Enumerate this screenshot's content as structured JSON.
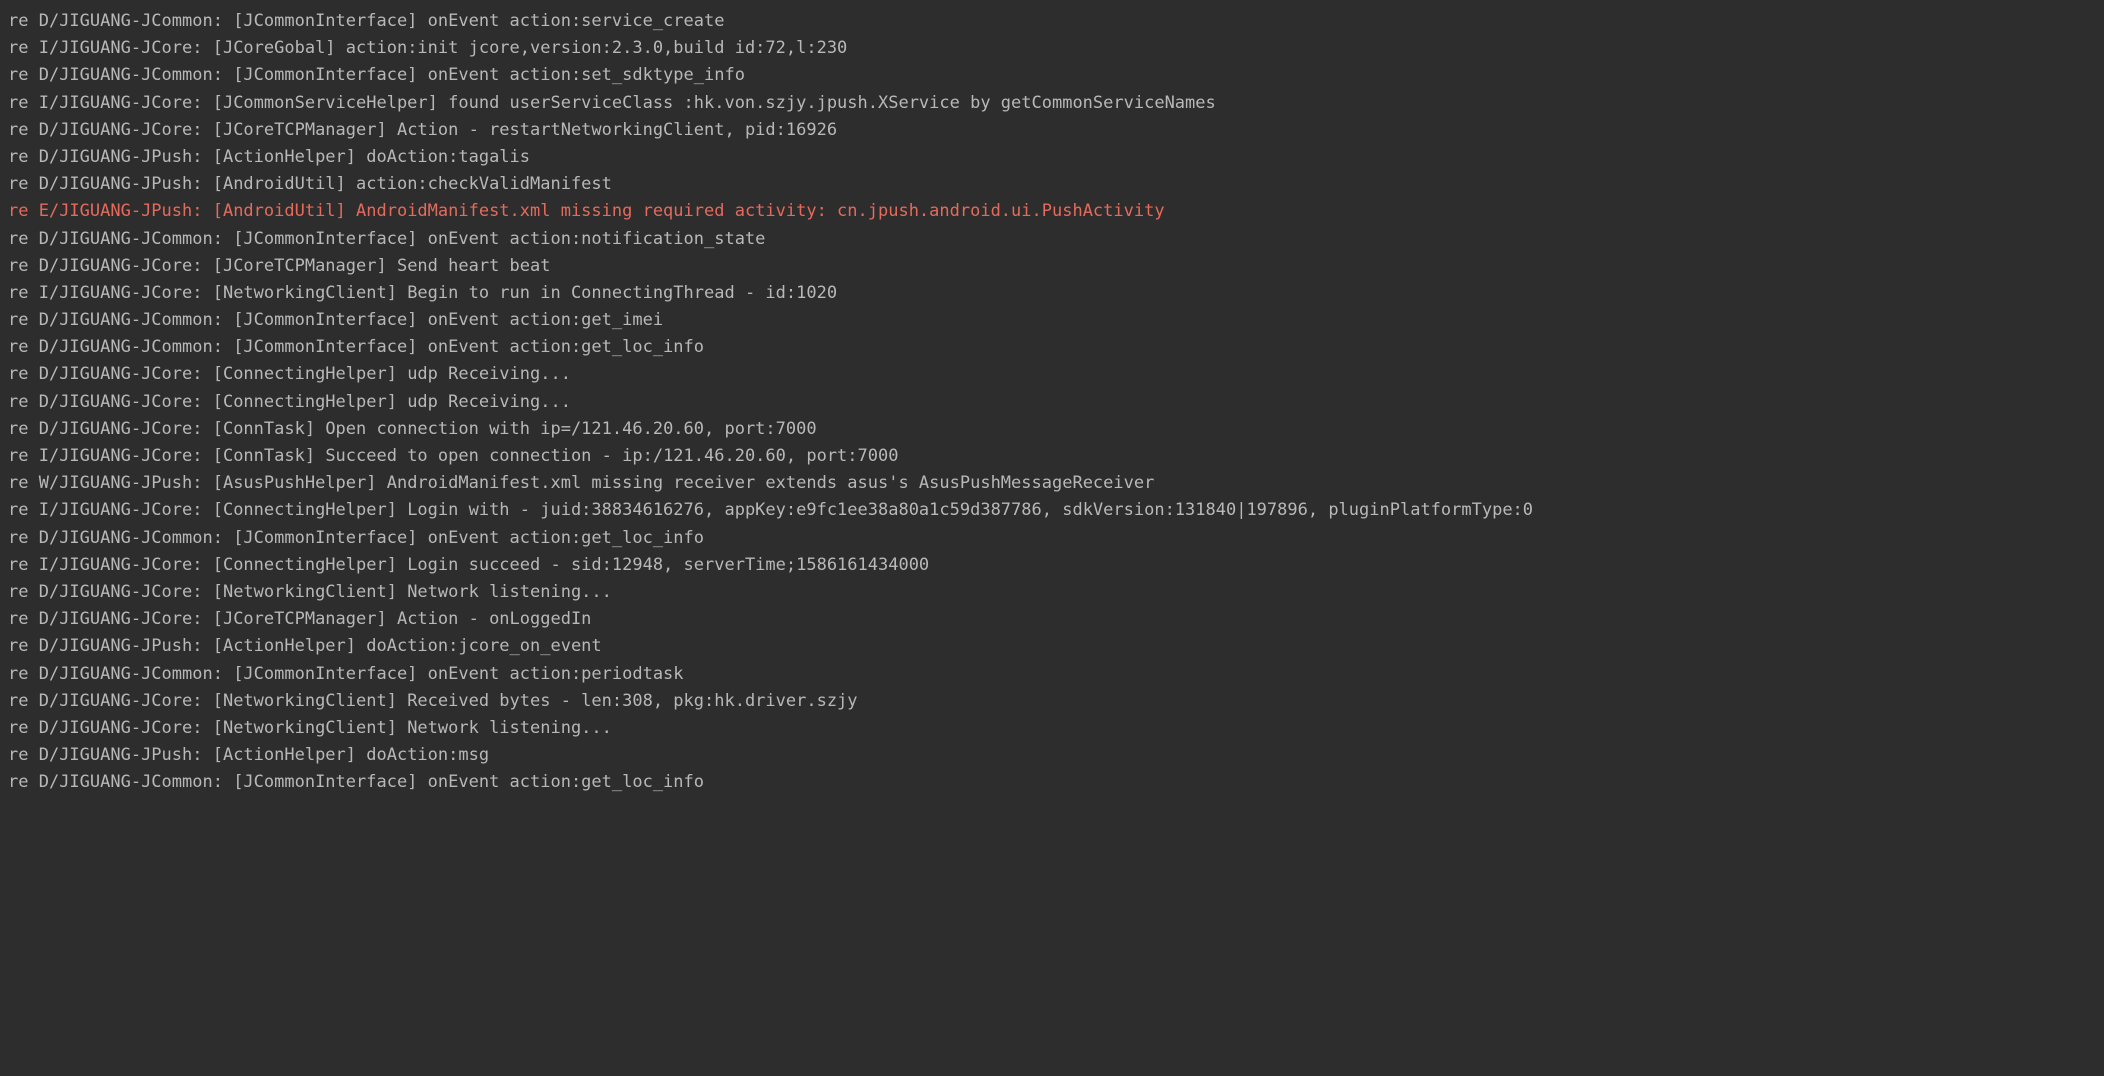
{
  "logs": [
    {
      "level": "D",
      "tag": "JIGUANG-JCommon",
      "component": "[JCommonInterface]",
      "msg": "onEvent action:service_create",
      "error": false
    },
    {
      "level": "I",
      "tag": "JIGUANG-JCore",
      "component": "[JCoreGobal]",
      "msg": "action:init jcore,version:2.3.0,build id:72,l:230",
      "error": false
    },
    {
      "level": "D",
      "tag": "JIGUANG-JCommon",
      "component": "[JCommonInterface]",
      "msg": "onEvent action:set_sdktype_info",
      "error": false
    },
    {
      "level": "I",
      "tag": "JIGUANG-JCore",
      "component": "[JCommonServiceHelper]",
      "msg": "found userServiceClass :hk.von.szjy.jpush.XService by getCommonServiceNames",
      "error": false
    },
    {
      "level": "D",
      "tag": "JIGUANG-JCore",
      "component": "[JCoreTCPManager]",
      "msg": "Action - restartNetworkingClient, pid:16926",
      "error": false
    },
    {
      "level": "D",
      "tag": "JIGUANG-JPush",
      "component": "[ActionHelper]",
      "msg": "doAction:tagalis",
      "error": false
    },
    {
      "level": "D",
      "tag": "JIGUANG-JPush",
      "component": "[AndroidUtil]",
      "msg": "action:checkValidManifest",
      "error": false
    },
    {
      "level": "E",
      "tag": "JIGUANG-JPush",
      "component": "[AndroidUtil]",
      "msg": "AndroidManifest.xml missing required activity: cn.jpush.android.ui.PushActivity",
      "error": true
    },
    {
      "level": "D",
      "tag": "JIGUANG-JCommon",
      "component": "[JCommonInterface]",
      "msg": "onEvent action:notification_state",
      "error": false
    },
    {
      "level": "D",
      "tag": "JIGUANG-JCore",
      "component": "[JCoreTCPManager]",
      "msg": "Send heart beat",
      "error": false
    },
    {
      "level": "I",
      "tag": "JIGUANG-JCore",
      "component": "[NetworkingClient]",
      "msg": "Begin to run in ConnectingThread - id:1020",
      "error": false
    },
    {
      "level": "D",
      "tag": "JIGUANG-JCommon",
      "component": "[JCommonInterface]",
      "msg": "onEvent action:get_imei",
      "error": false
    },
    {
      "level": "D",
      "tag": "JIGUANG-JCommon",
      "component": "[JCommonInterface]",
      "msg": "onEvent action:get_loc_info",
      "error": false
    },
    {
      "level": "D",
      "tag": "JIGUANG-JCore",
      "component": "[ConnectingHelper]",
      "msg": "udp Receiving...",
      "error": false
    },
    {
      "level": "D",
      "tag": "JIGUANG-JCore",
      "component": "[ConnectingHelper]",
      "msg": "udp Receiving...",
      "error": false
    },
    {
      "level": "D",
      "tag": "JIGUANG-JCore",
      "component": "[ConnTask]",
      "msg": "Open connection with ip=/121.46.20.60, port:7000",
      "error": false
    },
    {
      "level": "I",
      "tag": "JIGUANG-JCore",
      "component": "[ConnTask]",
      "msg": "Succeed to open connection - ip:/121.46.20.60, port:7000",
      "error": false
    },
    {
      "level": "W",
      "tag": "JIGUANG-JPush",
      "component": "[AsusPushHelper]",
      "msg": "AndroidManifest.xml missing receiver extends asus's AsusPushMessageReceiver",
      "error": false
    },
    {
      "level": "I",
      "tag": "JIGUANG-JCore",
      "component": "[ConnectingHelper]",
      "msg": "Login with - juid:38834616276, appKey:e9fc1ee38a80a1c59d387786, sdkVersion:131840|197896, pluginPlatformType:0",
      "error": false
    },
    {
      "level": "D",
      "tag": "JIGUANG-JCommon",
      "component": "[JCommonInterface]",
      "msg": "onEvent action:get_loc_info",
      "error": false
    },
    {
      "level": "I",
      "tag": "JIGUANG-JCore",
      "component": "[ConnectingHelper]",
      "msg": "Login succeed - sid:12948, serverTime;1586161434000",
      "error": false
    },
    {
      "level": "D",
      "tag": "JIGUANG-JCore",
      "component": "[NetworkingClient]",
      "msg": "Network listening...",
      "error": false
    },
    {
      "level": "D",
      "tag": "JIGUANG-JCore",
      "component": "[JCoreTCPManager]",
      "msg": "Action - onLoggedIn",
      "error": false
    },
    {
      "level": "D",
      "tag": "JIGUANG-JPush",
      "component": "[ActionHelper]",
      "msg": "doAction:jcore_on_event",
      "error": false
    },
    {
      "level": "D",
      "tag": "JIGUANG-JCommon",
      "component": "[JCommonInterface]",
      "msg": "onEvent action:periodtask",
      "error": false
    },
    {
      "level": "D",
      "tag": "JIGUANG-JCore",
      "component": "[NetworkingClient]",
      "msg": "Received bytes - len:308, pkg:hk.driver.szjy",
      "error": false
    },
    {
      "level": "D",
      "tag": "JIGUANG-JCore",
      "component": "[NetworkingClient]",
      "msg": "Network listening...",
      "error": false
    },
    {
      "level": "D",
      "tag": "JIGUANG-JPush",
      "component": "[ActionHelper]",
      "msg": "doAction:msg",
      "error": false
    },
    {
      "level": "D",
      "tag": "JIGUANG-JCommon",
      "component": "[JCommonInterface]",
      "msg": "onEvent action:get_loc_info",
      "error": false
    }
  ]
}
